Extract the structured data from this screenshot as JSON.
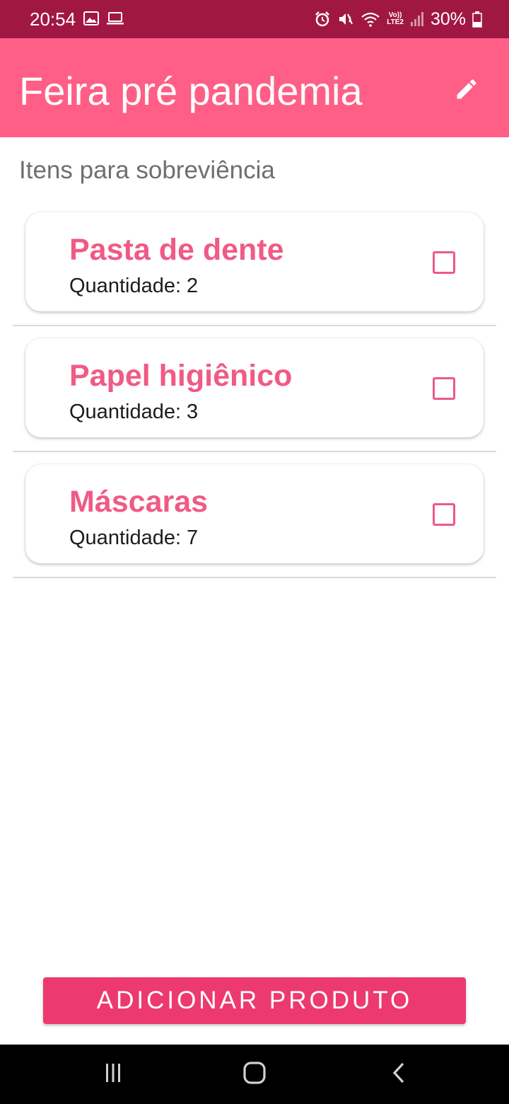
{
  "status_bar": {
    "time": "20:54",
    "battery": "30%",
    "network_label_top": "Vo))",
    "network_label_bottom": "LTE2",
    "left_icons": [
      "image-icon",
      "laptop-icon"
    ],
    "right_icons": [
      "alarm-icon",
      "mute-icon",
      "wifi-icon",
      "signal-icon",
      "battery-icon"
    ]
  },
  "app_bar": {
    "title": "Feira pré pandemia",
    "edit_icon": "pencil-icon"
  },
  "section_label": "Itens para sobreviência",
  "items": [
    {
      "name": "Pasta de dente",
      "quantity_label": "Quantidade:",
      "quantity": "2",
      "checked": false
    },
    {
      "name": "Papel higiênico",
      "quantity_label": "Quantidade:",
      "quantity": "3",
      "checked": false
    },
    {
      "name": "Máscaras",
      "quantity_label": "Quantidade:",
      "quantity": "7",
      "checked": false
    }
  ],
  "add_button_label": "ADICIONAR PRODUTO",
  "nav_bar": {
    "icons": [
      "recent-apps-icon",
      "home-icon",
      "back-icon"
    ]
  },
  "colors": {
    "status_bar": "#a11744",
    "app_bar": "#ff5e86",
    "accent": "#f05a86",
    "button": "#ec3a6f"
  }
}
